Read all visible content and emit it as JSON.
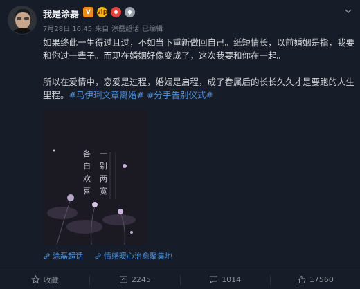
{
  "post": {
    "username": "我是涂磊",
    "badges": [
      "V",
      "vip",
      "红",
      "银"
    ],
    "meta": {
      "date": "7月28日 16:45",
      "source_prefix": "来自",
      "source": "涂磊超话",
      "status": "已编辑"
    },
    "paragraphs": [
      "如果终此一生得过且过，不如当下重新做回自己。纸短情长，以前婚姻是指，我要和你过一辈子。而现在婚姻好像变成了，这次我要和你在一起。",
      "所以在爱情中，恋爱是过程，婚姻是启程，成了眷属后的长长久久才是要跑的人生里程。"
    ],
    "tags": [
      "#马伊琍文章离婚#",
      "#分手告别仪式#"
    ],
    "poster": {
      "col1": "各自欢喜",
      "col2": "一别两宽"
    },
    "links": [
      {
        "label": "涂磊超话",
        "icon": "link-icon"
      },
      {
        "label": "情感暖心治愈聚集地",
        "icon": "link-icon"
      }
    ],
    "actions": {
      "collect": "收藏",
      "repost": "2245",
      "comment": "1014",
      "like": "17560"
    },
    "colors": {
      "accent": "#4f8fd9",
      "background": "#161d28"
    }
  }
}
